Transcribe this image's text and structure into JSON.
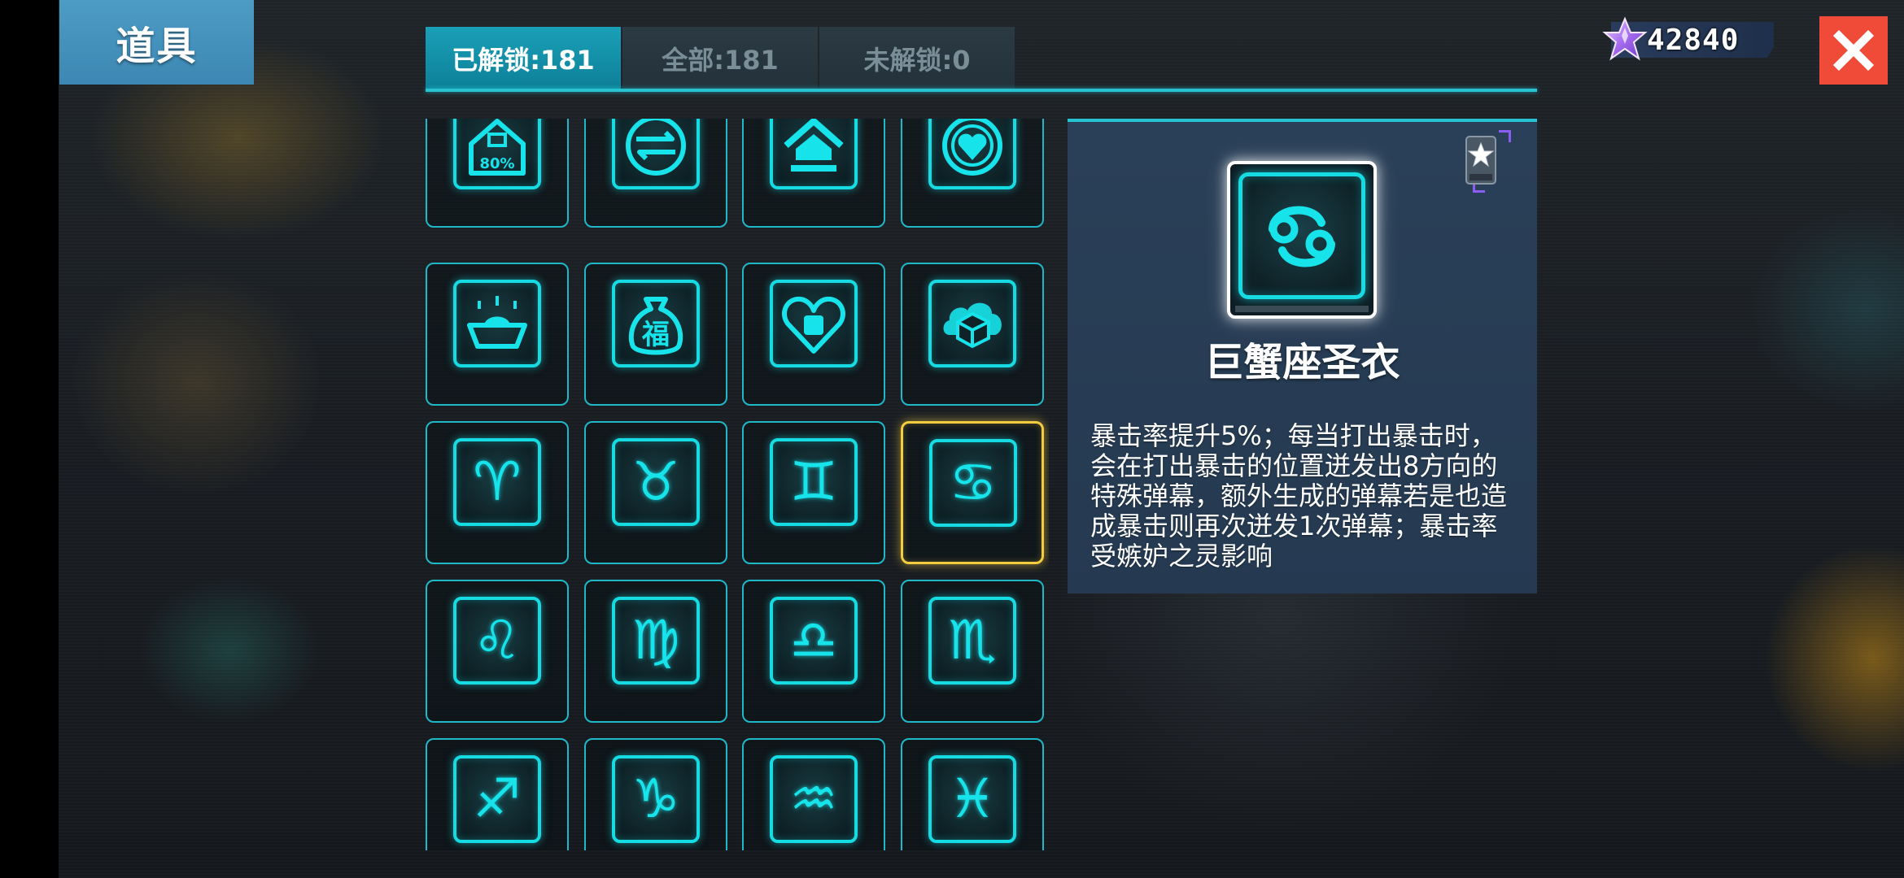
{
  "page": {
    "title": "道具"
  },
  "tabs": [
    {
      "label": "已解锁:181",
      "active": true
    },
    {
      "label": "全部:181",
      "active": false
    },
    {
      "label": "未解锁:0",
      "active": false
    }
  ],
  "currency": {
    "icon": "purple-star-gem-icon",
    "value": "42840"
  },
  "close": {
    "icon": "close-icon"
  },
  "items": [
    {
      "name": "house-discount-icon",
      "label": "80%"
    },
    {
      "name": "exchange-circle-icon",
      "label": ""
    },
    {
      "name": "house-home-icon",
      "label": ""
    },
    {
      "name": "heart-shield-icon",
      "label": ""
    },
    {
      "name": "gold-ingot-icon",
      "label": ""
    },
    {
      "name": "fortune-bag-icon",
      "label": "福"
    },
    {
      "name": "heart-fist-icon",
      "label": ""
    },
    {
      "name": "gift-box-cloud-icon",
      "label": ""
    },
    {
      "name": "aries-icon",
      "label": "♈"
    },
    {
      "name": "taurus-icon",
      "label": "♉"
    },
    {
      "name": "gemini-icon",
      "label": "♊"
    },
    {
      "name": "cancer-icon",
      "label": "♋",
      "selected": true
    },
    {
      "name": "leo-icon",
      "label": "♌"
    },
    {
      "name": "virgo-icon",
      "label": "♍"
    },
    {
      "name": "libra-icon",
      "label": "♎"
    },
    {
      "name": "scorpio-icon",
      "label": "♏"
    },
    {
      "name": "sagittarius-icon",
      "label": "♐"
    },
    {
      "name": "capricorn-icon",
      "label": "♑"
    },
    {
      "name": "aquarius-icon",
      "label": "♒"
    },
    {
      "name": "pisces-icon",
      "label": "♓"
    }
  ],
  "detail": {
    "icon": "cancer-icon",
    "glyph": "♋",
    "name": "巨蟹座圣衣",
    "description": "暴击率提升5%；每当打出暴击时，会在打出暴击的位置迸发出8方向的特殊弹幕，额外生成的弹幕若是也造成暴击则再次迸发1次弹幕；暴击率受嫉妒之灵影响",
    "badge_icon": "star-badge-icon"
  },
  "colors": {
    "accent_cyan": "#16dbe3",
    "selected_gold": "#f4cc3f",
    "title_blue": "#4d9cc6",
    "close_red": "#ef4b38",
    "panel_blue": "#2a4058"
  }
}
